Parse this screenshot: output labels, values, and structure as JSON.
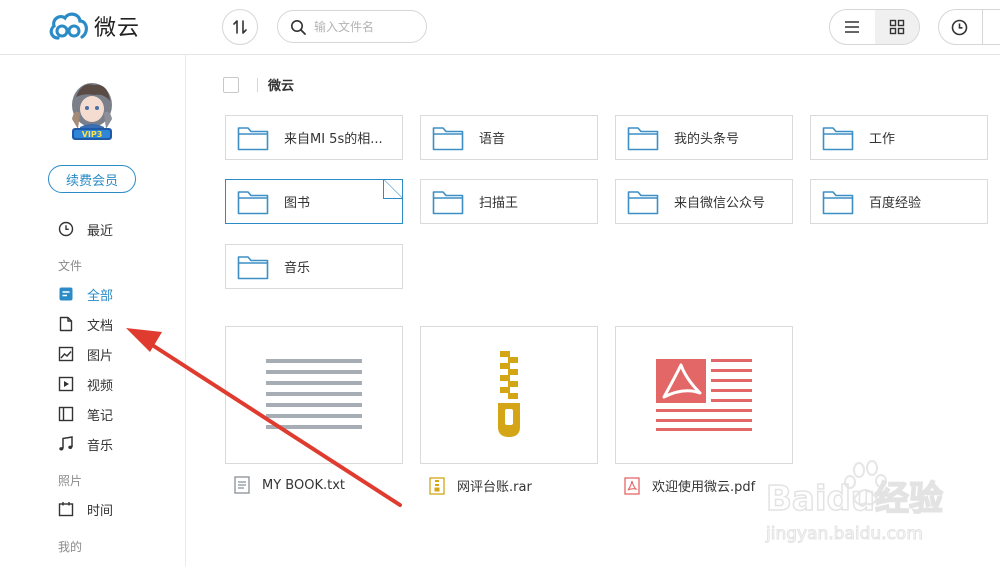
{
  "app": {
    "name": "微云"
  },
  "search": {
    "placeholder": "输入文件名"
  },
  "sidebar": {
    "renew_label": "续费会员",
    "vip_badge": "VIP3",
    "nav": [
      {
        "label": "最近",
        "icon": "clock-icon"
      },
      {
        "label": "全部",
        "icon": "all-files-icon"
      },
      {
        "label": "文档",
        "icon": "document-icon"
      },
      {
        "label": "图片",
        "icon": "image-icon"
      },
      {
        "label": "视频",
        "icon": "video-icon"
      },
      {
        "label": "笔记",
        "icon": "notes-icon"
      },
      {
        "label": "音乐",
        "icon": "music-icon"
      },
      {
        "label": "时间",
        "icon": "calendar-icon"
      }
    ],
    "sections": {
      "files": "文件",
      "photos": "照片",
      "mine": "我的"
    }
  },
  "breadcrumb": {
    "current": "微云"
  },
  "folders": [
    {
      "name": "来自MI 5s的相..."
    },
    {
      "name": "语音"
    },
    {
      "name": "我的头条号"
    },
    {
      "name": "工作"
    },
    {
      "name": "图书"
    },
    {
      "name": "扫描王"
    },
    {
      "name": "来自微信公众号"
    },
    {
      "name": "百度经验"
    },
    {
      "name": "音乐"
    }
  ],
  "files": [
    {
      "name": "MY BOOK.txt",
      "type": "txt"
    },
    {
      "name": "网评台账.rar",
      "type": "rar"
    },
    {
      "name": "欢迎使用微云.pdf",
      "type": "pdf"
    }
  ],
  "watermark": {
    "brand": "Baidu经验",
    "url": "jingyan.baidu.com"
  },
  "colors": {
    "accent": "#2a8bc6",
    "folder": "#3d8fc6",
    "zip": "#d4a514",
    "pdf": "#e46767"
  }
}
